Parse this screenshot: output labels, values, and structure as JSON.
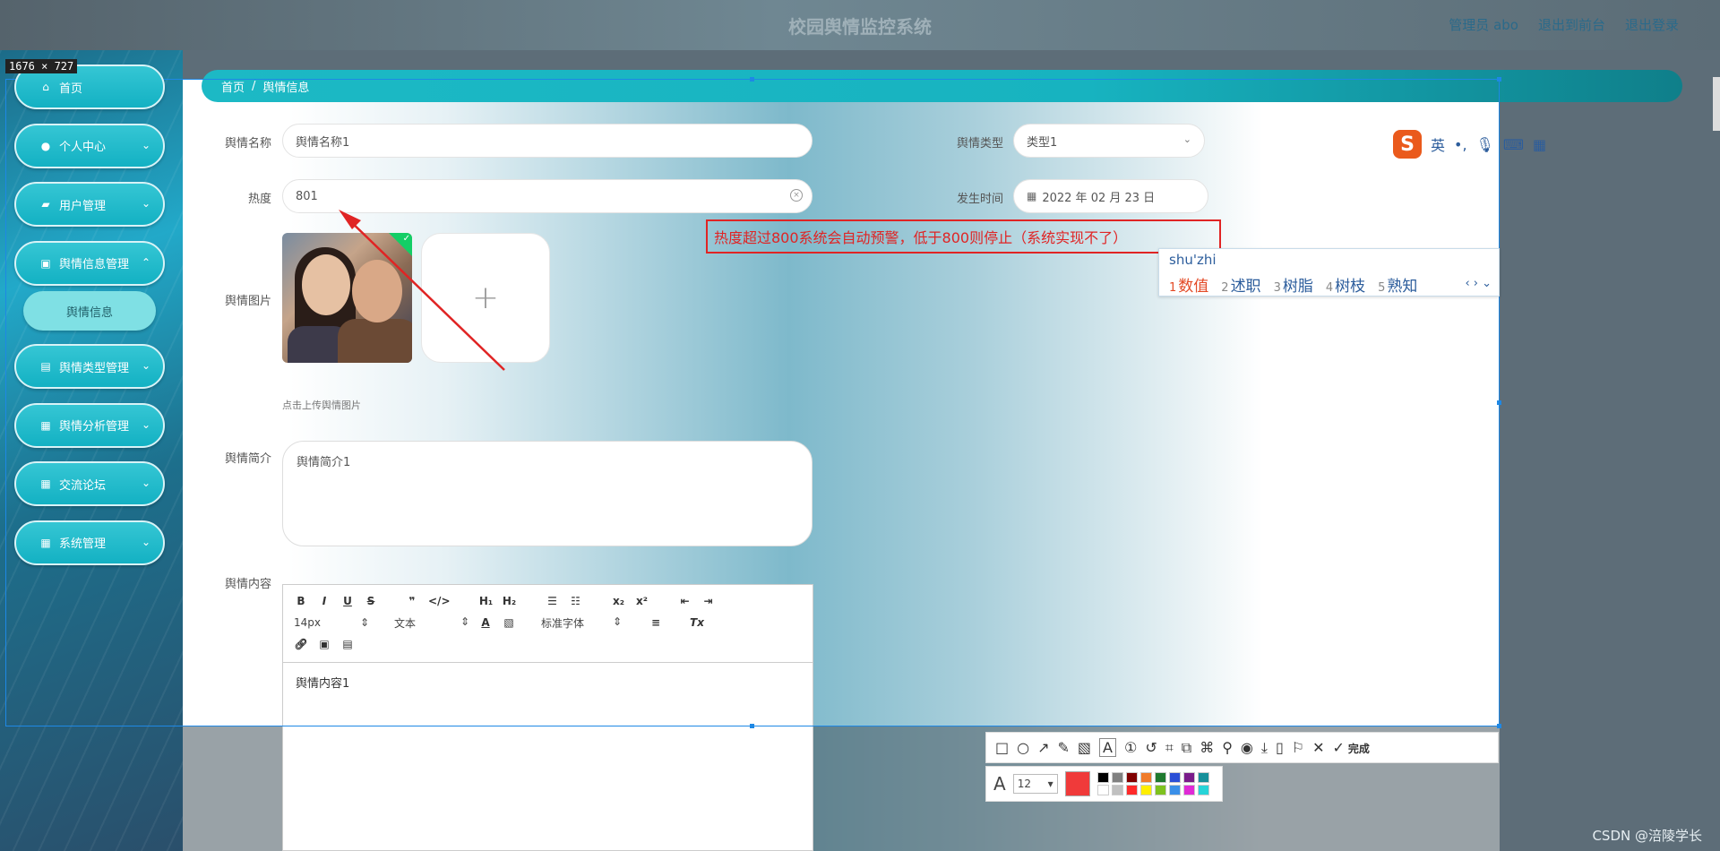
{
  "header": {
    "title": "校园舆情监控系统",
    "admin": "管理员 abo",
    "front": "退出到前台",
    "logout": "退出登录"
  },
  "size_badge": "1676 × 727",
  "sidebar": {
    "items": [
      {
        "label": "首页",
        "icon": "home-icon"
      },
      {
        "label": "个人中心",
        "icon": "user-icon"
      },
      {
        "label": "用户管理",
        "icon": "chat-icon"
      },
      {
        "label": "舆情信息管理",
        "icon": "briefcase-icon"
      },
      {
        "label": "舆情类型管理",
        "icon": "clipboard-icon"
      },
      {
        "label": "舆情分析管理",
        "icon": "grid-icon"
      },
      {
        "label": "交流论坛",
        "icon": "grid-icon"
      },
      {
        "label": "系统管理",
        "icon": "grid-icon"
      }
    ],
    "sub_item": "舆情信息"
  },
  "breadcrumb": {
    "home": "首页",
    "sep": "/",
    "current": "舆情信息"
  },
  "form": {
    "name_label": "舆情名称",
    "name_value": "舆情名称1",
    "type_label": "舆情类型",
    "type_value": "类型1",
    "heat_label": "热度",
    "heat_value": "801",
    "time_label": "发生时间",
    "time_value": "2022 年 02 月 23 日",
    "image_label": "舆情图片",
    "image_hint": "点击上传舆情图片",
    "upload_plus": "+",
    "intro_label": "舆情简介",
    "intro_value": "舆情简介1",
    "content_label": "舆情内容",
    "content_value": "舆情内容1"
  },
  "editor_toolbar": {
    "font_size": "14px",
    "text_type": "文本",
    "font_family": "标准字体",
    "bold": "B",
    "italic": "I",
    "underline": "U",
    "strike": "S",
    "quote": "❞",
    "code": "</>",
    "h1": "H₁",
    "h2": "H₂",
    "sub": "x₂",
    "sup": "x²",
    "clean": "Tx"
  },
  "annotation": {
    "text": "热度超过800系统会自动预警，低于800则停止（系统实现不了）"
  },
  "ime": {
    "pinyin": "shu'zhi",
    "candidates": [
      {
        "n": "1",
        "w": "数值"
      },
      {
        "n": "2",
        "w": "述职"
      },
      {
        "n": "3",
        "w": "树脂"
      },
      {
        "n": "4",
        "w": "树枝"
      },
      {
        "n": "5",
        "w": "熟知"
      }
    ],
    "mode": "英",
    "punct": "•,"
  },
  "snip_toolbar": {
    "done": "完成",
    "font_size": "12"
  },
  "palette": [
    "#000000",
    "#808080",
    "#800000",
    "#f07b2a",
    "#1f7a2f",
    "#2b4fd6",
    "#7a1c8a",
    "#17909a",
    "#ffffff",
    "#c0c0c0",
    "#ff2a2a",
    "#ffee00",
    "#7ec21f",
    "#3a8fe8",
    "#e02ad6",
    "#27d4d8"
  ],
  "watermark": "CSDN @涪陵学长"
}
